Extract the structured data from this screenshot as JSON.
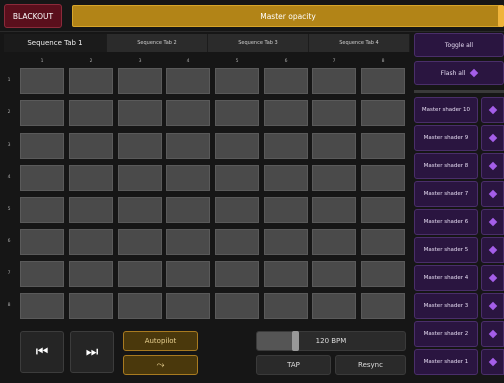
{
  "top": {
    "blackout_label": "BLACKOUT",
    "opacity_label": "Master opacity",
    "opacity_level": 1.0
  },
  "tabs": [
    {
      "label": "Sequence Tab 1",
      "active": true
    },
    {
      "label": "Sequence Tab 2",
      "active": false
    },
    {
      "label": "Sequence Tab 3",
      "active": false
    },
    {
      "label": "Sequence Tab 4",
      "active": false
    }
  ],
  "grid": {
    "columns": [
      "1",
      "2",
      "3",
      "4",
      "5",
      "6",
      "7",
      "8"
    ],
    "rows": [
      "1",
      "2",
      "3",
      "4",
      "5",
      "6",
      "7",
      "8"
    ]
  },
  "controls": {
    "prev_icon": "skip-previous-icon",
    "next_icon": "skip-next-icon",
    "autopilot_label": "Autopilot",
    "shuffle_icon": "shuffle-icon",
    "bpm_label": "120 BPM",
    "tap_label": "TAP",
    "resync_label": "Resync"
  },
  "right_panel": {
    "toggle_all_label": "Toggle all",
    "flash_all_label": "Flash all",
    "shaders": [
      {
        "label": "Master shader 10"
      },
      {
        "label": "Master shader 9"
      },
      {
        "label": "Master shader 8"
      },
      {
        "label": "Master shader 7"
      },
      {
        "label": "Master shader 6"
      },
      {
        "label": "Master shader 5"
      },
      {
        "label": "Master shader 4"
      },
      {
        "label": "Master shader 3"
      },
      {
        "label": "Master shader 2"
      },
      {
        "label": "Master shader 1"
      }
    ]
  },
  "colors": {
    "accent_gold": "#b28417",
    "blackout_red": "#5a0f1c",
    "purple": "#a45ee8",
    "cell_gray": "#4a4a4a"
  }
}
